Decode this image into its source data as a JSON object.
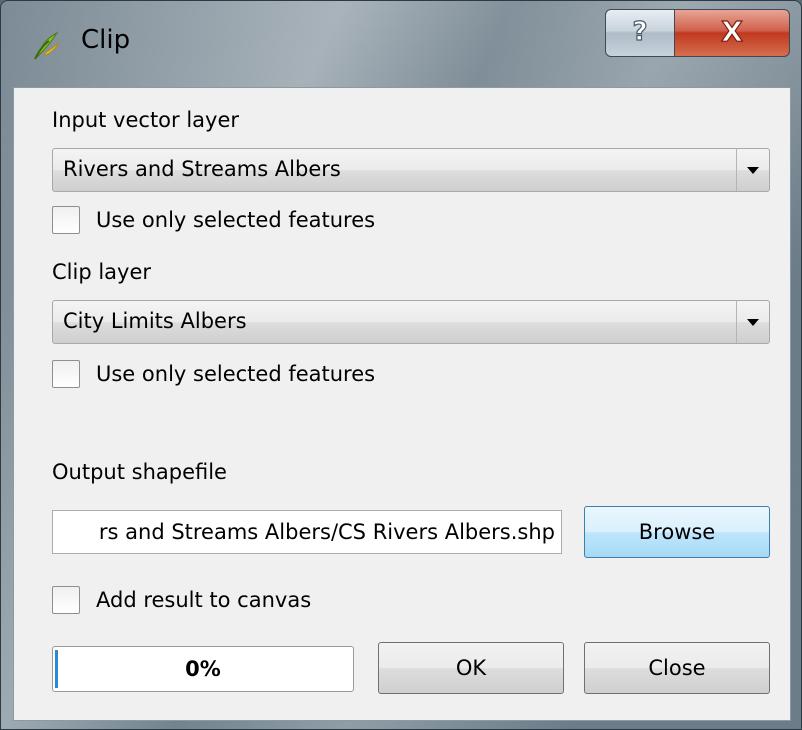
{
  "window": {
    "title": "Clip",
    "help_glyph": "?",
    "close_glyph": "X",
    "icon": "qgis-icon"
  },
  "input": {
    "label": "Input vector layer",
    "selected": "Rivers and Streams Albers",
    "selected_only_label": "Use only selected features",
    "selected_only_checked": false
  },
  "clip": {
    "label": "Clip layer",
    "selected": "City Limits Albers",
    "selected_only_label": "Use only selected features",
    "selected_only_checked": false
  },
  "output": {
    "label": "Output shapefile",
    "value": "rs and Streams Albers/CS Rivers Albers.shp",
    "browse_label": "Browse",
    "add_to_canvas_label": "Add result to canvas",
    "add_to_canvas_checked": false
  },
  "footer": {
    "progress_text": "0%",
    "progress_value": 0,
    "ok_label": "OK",
    "close_label": "Close"
  },
  "colors": {
    "progress_fill": "#2a8ad4",
    "close_button": "#c0391f"
  }
}
